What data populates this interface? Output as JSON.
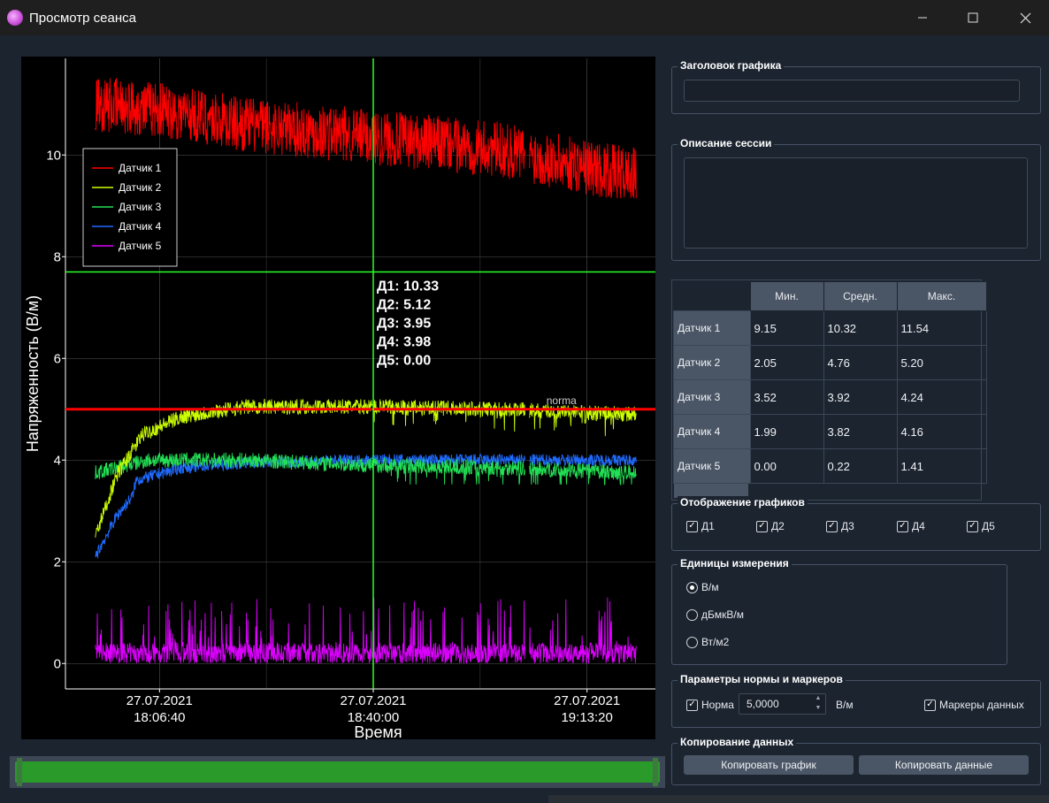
{
  "window": {
    "title": "Просмотр сеанса",
    "minimize_icon": "minimize-icon",
    "maximize_icon": "maximize-icon",
    "close_icon": "close-icon"
  },
  "chart_data": {
    "type": "line",
    "xlabel": "Время",
    "ylabel": "Напряженность (В/м)",
    "ylim": [
      -0.5,
      11.9
    ],
    "yticks": [
      0,
      2,
      4,
      6,
      8,
      10
    ],
    "xticks": [
      {
        "date": "27.07.2021",
        "time": "18:06:40"
      },
      {
        "date": "27.07.2021",
        "time": "18:40:00"
      },
      {
        "date": "27.07.2021",
        "time": "19:13:20"
      }
    ],
    "xlim": [
      "17:52:00",
      "19:24:00"
    ],
    "x_start": "17:56:40",
    "x_end": "19:21:00",
    "grid": true,
    "legend_position": "top-left",
    "series": [
      {
        "name": "Датчик 1",
        "color": "#ff0000",
        "min": 9.15,
        "mean": 10.32,
        "max": 11.54,
        "trend": [
          [
            "17:56:40",
            11.0
          ],
          [
            "18:06:40",
            10.9
          ],
          [
            "18:20:00",
            10.6
          ],
          [
            "18:40:00",
            10.35
          ],
          [
            "19:00:00",
            10.1
          ],
          [
            "19:20:00",
            9.6
          ]
        ]
      },
      {
        "name": "Датчик 2",
        "color": "#ccff00",
        "min": 2.05,
        "mean": 4.76,
        "max": 5.2,
        "trend": [
          [
            "17:56:40",
            2.5
          ],
          [
            "18:00:00",
            3.7
          ],
          [
            "18:04:00",
            4.5
          ],
          [
            "18:10:00",
            4.85
          ],
          [
            "18:20:00",
            5.05
          ],
          [
            "18:40:00",
            5.05
          ],
          [
            "19:00:00",
            5.0
          ],
          [
            "19:20:00",
            4.9
          ]
        ]
      },
      {
        "name": "Датчик 3",
        "color": "#22e055",
        "min": 3.52,
        "mean": 3.92,
        "max": 4.24,
        "trend": [
          [
            "17:56:40",
            3.75
          ],
          [
            "18:05:00",
            4.0
          ],
          [
            "18:20:00",
            4.0
          ],
          [
            "18:40:00",
            3.9
          ],
          [
            "19:00:00",
            3.85
          ],
          [
            "19:20:00",
            3.75
          ]
        ]
      },
      {
        "name": "Датчик 4",
        "color": "#1f6bff",
        "min": 1.99,
        "mean": 3.82,
        "max": 4.16,
        "trend": [
          [
            "17:56:40",
            2.1
          ],
          [
            "18:00:00",
            2.9
          ],
          [
            "18:02:30",
            3.3
          ],
          [
            "18:03:00",
            3.6
          ],
          [
            "18:10:00",
            3.85
          ],
          [
            "18:20:00",
            3.95
          ],
          [
            "18:40:00",
            4.0
          ],
          [
            "19:00:00",
            4.0
          ],
          [
            "19:20:00",
            4.0
          ]
        ]
      },
      {
        "name": "Датчик 5",
        "color": "#dd00ff",
        "min": 0.0,
        "mean": 0.22,
        "max": 1.41,
        "trend": [
          [
            "17:56:40",
            0.2
          ],
          [
            "18:40:00",
            0.25
          ],
          [
            "19:20:00",
            0.22
          ]
        ]
      }
    ],
    "norm_line": {
      "value": 5.0,
      "label": "norma",
      "color": "#ff0000"
    },
    "cursor": {
      "x": "18:40:00",
      "y": 7.7,
      "color": "#2bff2b"
    },
    "cursor_readout": [
      "Д1: 10.33",
      "Д2: 5.12",
      "Д3: 3.95",
      "Д4: 3.98",
      "Д5: 0.00"
    ]
  },
  "panel": {
    "chart_title_group": "Заголовок графика",
    "chart_title_value": "",
    "session_desc_group": "Описание сессии",
    "session_desc_value": "",
    "table": {
      "columns": [
        "Мин.",
        "Средн.",
        "Макс."
      ],
      "rows": [
        {
          "label": "Датчик 1",
          "min": "9.15",
          "mean": "10.32",
          "max": "11.54"
        },
        {
          "label": "Датчик 2",
          "min": "2.05",
          "mean": "4.76",
          "max": "5.20"
        },
        {
          "label": "Датчик 3",
          "min": "3.52",
          "mean": "3.92",
          "max": "4.24"
        },
        {
          "label": "Датчик 4",
          "min": "1.99",
          "mean": "3.82",
          "max": "4.16"
        },
        {
          "label": "Датчик 5",
          "min": "0.00",
          "mean": "0.22",
          "max": "1.41"
        }
      ]
    },
    "display_group": "Отображение графиков",
    "display_checks": [
      {
        "label": "Д1",
        "checked": true
      },
      {
        "label": "Д2",
        "checked": true
      },
      {
        "label": "Д3",
        "checked": true
      },
      {
        "label": "Д4",
        "checked": true
      },
      {
        "label": "Д5",
        "checked": true
      }
    ],
    "units_group": "Единицы измерения",
    "units_options": [
      {
        "label": "В/м",
        "selected": true
      },
      {
        "label": "дБмкВ/м",
        "selected": false
      },
      {
        "label": "Вт/м2",
        "selected": false
      }
    ],
    "norm_group": "Параметры нормы и маркеров",
    "norm_check_label": "Норма",
    "norm_checked": true,
    "norm_value": "5,0000",
    "norm_unit": "В/м",
    "markers_label": "Маркеры данных",
    "markers_checked": true,
    "copy_group": "Копирование данных",
    "copy_chart_button": "Копировать график",
    "copy_data_button": "Копировать данные"
  }
}
